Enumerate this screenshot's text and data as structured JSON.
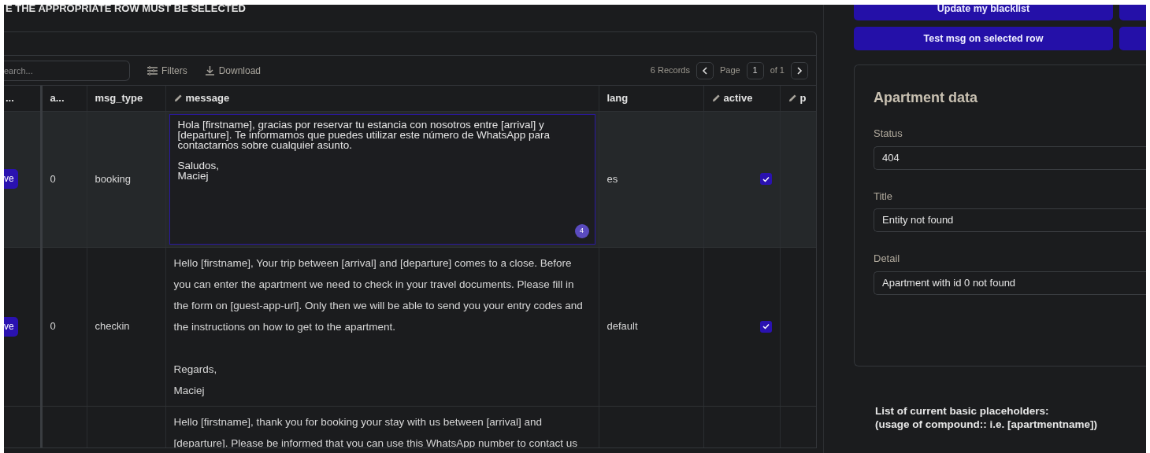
{
  "instruction": "E THE APPROPRIATE ROW MUST BE SELECTED",
  "table": {
    "search": {
      "placeholder": "earch..."
    },
    "tools": [
      {
        "kind": "filters",
        "label": "Filters"
      },
      {
        "kind": "download",
        "label": "Download"
      }
    ],
    "records": "6 Records",
    "page_label": "Page",
    "page": "1",
    "page_of": "of 1",
    "columns": [
      {
        "label": "...",
        "editable": false
      },
      {
        "label": "a...",
        "editable": false
      },
      {
        "label": "msg_type",
        "editable": false
      },
      {
        "label": "message",
        "editable": true
      },
      {
        "label": "lang",
        "editable": false
      },
      {
        "label": "active",
        "editable": true
      },
      {
        "label": "p",
        "editable": true
      }
    ],
    "rows": [
      {
        "selected": true,
        "action": "ve",
        "a": "0",
        "msg_type": "booking",
        "editing": true,
        "message": "Hola [firstname], gracias por reservar tu estancia con nosotros entre [arrival] y [departure]. Te informamos que puedes utilizar este número de WhatsApp para contactarnos sobre cualquier asunto.\n\nSaludos,\nMaciej",
        "badge": "4",
        "lang": "es",
        "active": true
      },
      {
        "selected": false,
        "action": "ve",
        "a": "0",
        "msg_type": "checkin",
        "editing": false,
        "message": "Hello [firstname], Your trip between [arrival] and [departure] comes to a close. Before you can enter the apartment we need to check in your travel documents. Please fill in the form on [guest-app-url]. Only then we will be able to send you your entry codes and the instructions on how to get to the apartment.\n\nRegards,\nMaciej",
        "lang": "default",
        "active": true
      },
      {
        "selected": false,
        "editing": false,
        "message": "Hello [firstname], thank you for booking your stay with us between [arrival] and [departure]. Please be informed that you can use this WhatsApp number to contact us"
      }
    ]
  },
  "actions": [
    {
      "label": "Update my blacklist"
    },
    {
      "label": "Test msg on selected row"
    }
  ],
  "apartment": {
    "title": "Apartment data",
    "fields": [
      {
        "label": "Status",
        "value": "404"
      },
      {
        "label": "Title",
        "value": "Entity not found"
      },
      {
        "label": "Detail",
        "value": "Apartment with id 0 not found"
      }
    ]
  },
  "placeholders_note": [
    "List of current basic placeholders:",
    "(usage of compound:: i.e. [apartmentname])"
  ]
}
